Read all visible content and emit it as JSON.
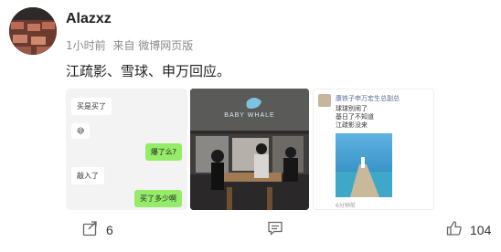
{
  "post": {
    "username": "Alazxz",
    "time": "1小时前",
    "source": "来自 微博网页版",
    "text": "江疏影、雪球、申万回应。"
  },
  "images": {
    "chat": {
      "messages": [
        {
          "side": "left",
          "text": "买是买了"
        },
        {
          "side": "left",
          "text": "😅"
        },
        {
          "side": "right",
          "text": "爆了么?"
        },
        {
          "side": "left",
          "text": "敲入了"
        },
        {
          "side": "right",
          "text": "买了多少啊"
        }
      ]
    },
    "cafe": {
      "sign": "BABY WHALE"
    },
    "moments": {
      "user": "康铁子申万宏生总副总",
      "lines": [
        "球球别闹了",
        "基日了不知道",
        "江疏影没来"
      ],
      "footer": "6分钟前"
    }
  },
  "actions": {
    "repost_count": "6",
    "comment_count": "",
    "like_count": "104"
  },
  "colors": {
    "chat_green": "#95ec69",
    "muted_text": "#8a8a8a"
  }
}
